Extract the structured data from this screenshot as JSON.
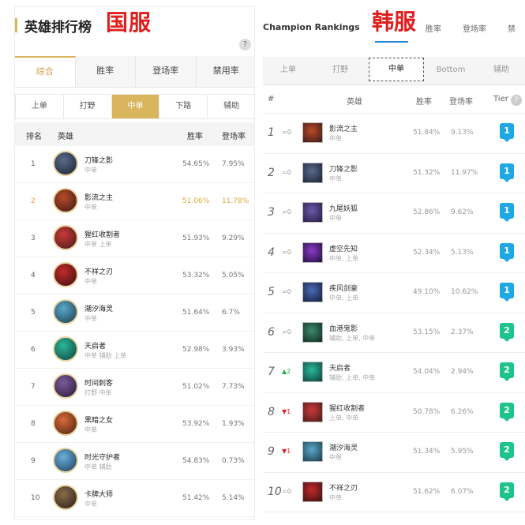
{
  "colors": {
    "gold": "#d9b65d",
    "region": "#e01e1e",
    "tier1": "#1ea9e6",
    "tier2": "#1fc48c",
    "kr_accent": "#2a86d6"
  },
  "cn": {
    "title": "英雄排行榜",
    "region": "国服",
    "help_icon": "?",
    "tabs": [
      "综合",
      "胜率",
      "登场率",
      "禁用率"
    ],
    "positions": [
      "上单",
      "打野",
      "中单",
      "下路",
      "辅助"
    ],
    "columns": {
      "rank": "排名",
      "hero": "英雄",
      "win": "胜率",
      "pick": "登场率"
    },
    "rows": [
      {
        "rank": "1",
        "name": "刀锋之影",
        "role": "中单",
        "win": "54.65%",
        "pick": "7.95%",
        "c1": "#5a6a8a",
        "c2": "#1a2234"
      },
      {
        "rank": "2",
        "name": "影流之主",
        "role": "中单",
        "win": "51.06%",
        "pick": "11.78%",
        "c1": "#b84a2a",
        "c2": "#3a1a14"
      },
      {
        "rank": "3",
        "name": "猩红收割者",
        "role": "中单 上单",
        "win": "51.93%",
        "pick": "9.29%",
        "c1": "#c83a3a",
        "c2": "#4a1818"
      },
      {
        "rank": "4",
        "name": "不祥之刃",
        "role": "中单",
        "win": "53.32%",
        "pick": "5.05%",
        "c1": "#c22a2a",
        "c2": "#3a1010"
      },
      {
        "rank": "5",
        "name": "潮汐海灵",
        "role": "中单",
        "win": "51.64%",
        "pick": "6.7%",
        "c1": "#5aa8c8",
        "c2": "#1a3a4a"
      },
      {
        "rank": "6",
        "name": "天启者",
        "role": "中单 辅助 上单",
        "win": "52.98%",
        "pick": "3.93%",
        "c1": "#2ab89a",
        "c2": "#10403a"
      },
      {
        "rank": "7",
        "name": "时间刺客",
        "role": "打野 中单",
        "win": "51.02%",
        "pick": "7.73%",
        "c1": "#7a5a9a",
        "c2": "#261a34"
      },
      {
        "rank": "8",
        "name": "黑暗之女",
        "role": "中单",
        "win": "53.92%",
        "pick": "1.93%",
        "c1": "#d86a3a",
        "c2": "#4a2010"
      },
      {
        "rank": "9",
        "name": "时光守护者",
        "role": "中单 辅助",
        "win": "54.83%",
        "pick": "0.73%",
        "c1": "#6ab0d8",
        "c2": "#203a5a"
      },
      {
        "rank": "10",
        "name": "卡牌大师",
        "role": "中单",
        "win": "51.42%",
        "pick": "5.14%",
        "c1": "#8a6a4a",
        "c2": "#2a2018"
      }
    ]
  },
  "kr": {
    "title": "Champion Rankings",
    "region": "韩服",
    "tabs": [
      "胜率",
      "登场率",
      "禁"
    ],
    "positions": [
      "上单",
      "打野",
      "中单",
      "Bottom",
      "辅助"
    ],
    "columns": {
      "num": "#",
      "hero": "英雄",
      "win": "胜率",
      "pick": "登场率",
      "tier": "Tier"
    },
    "help_icon": "?",
    "rows": [
      {
        "num": "1",
        "change": "=0",
        "dir": "same",
        "name": "影流之主",
        "role": "中单",
        "win": "51.84%",
        "pick": "9.13%",
        "tier": "1",
        "c1": "#b84a2a",
        "c2": "#3a1a14"
      },
      {
        "num": "2",
        "change": "=0",
        "dir": "same",
        "name": "刀锋之影",
        "role": "中单",
        "win": "51.32%",
        "pick": "11.97%",
        "tier": "1",
        "c1": "#5a6a8a",
        "c2": "#1a2234"
      },
      {
        "num": "3",
        "change": "=0",
        "dir": "same",
        "name": "九尾妖狐",
        "role": "中单",
        "win": "52.86%",
        "pick": "9.62%",
        "tier": "1",
        "c1": "#6a5aa8",
        "c2": "#241a40"
      },
      {
        "num": "4",
        "change": "=0",
        "dir": "same",
        "name": "虚空先知",
        "role": "中单, 上单",
        "win": "52.34%",
        "pick": "5.13%",
        "tier": "1",
        "c1": "#8a3ac8",
        "c2": "#20103a"
      },
      {
        "num": "5",
        "change": "=0",
        "dir": "same",
        "name": "疾风剑豪",
        "role": "中单, 上单",
        "win": "49.10%",
        "pick": "10.62%",
        "tier": "1",
        "c1": "#4a6ab8",
        "c2": "#141e3a"
      },
      {
        "num": "6",
        "change": "=0",
        "dir": "same",
        "name": "血港鬼影",
        "role": "辅助, 上单, 中单",
        "win": "53.15%",
        "pick": "2.37%",
        "tier": "2",
        "c1": "#3a8a6a",
        "c2": "#102a20"
      },
      {
        "num": "7",
        "change": "▲2",
        "dir": "up",
        "name": "天启者",
        "role": "辅助, 上单, 中单",
        "win": "54.04%",
        "pick": "2.94%",
        "tier": "2",
        "c1": "#2ab89a",
        "c2": "#10403a"
      },
      {
        "num": "8",
        "change": "▼1",
        "dir": "down",
        "name": "猩红收割者",
        "role": "上单, 中单",
        "win": "50.78%",
        "pick": "6.26%",
        "tier": "2",
        "c1": "#c83a3a",
        "c2": "#4a1818"
      },
      {
        "num": "9",
        "change": "▼1",
        "dir": "down",
        "name": "潮汐海灵",
        "role": "中单",
        "win": "51.34%",
        "pick": "5.95%",
        "tier": "2",
        "c1": "#5aa8c8",
        "c2": "#1a3a4a"
      },
      {
        "num": "10",
        "change": "=0",
        "dir": "same",
        "name": "不祥之刃",
        "role": "中单",
        "win": "51.62%",
        "pick": "6.07%",
        "tier": "2",
        "c1": "#c22a2a",
        "c2": "#3a1010"
      }
    ]
  }
}
